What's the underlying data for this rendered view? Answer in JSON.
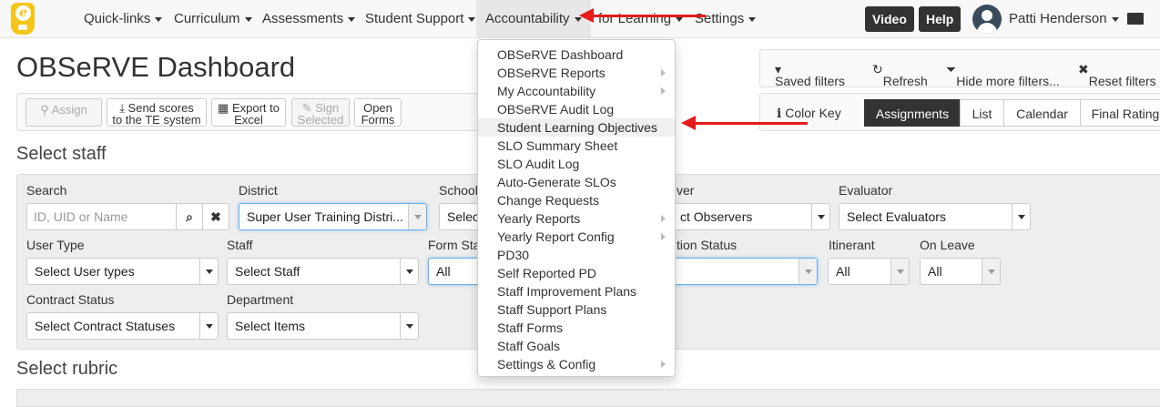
{
  "nav": {
    "items": [
      "Quick-links",
      "Curriculum",
      "Assessments",
      "Student Support",
      "Accountability",
      "for Learning",
      "Settings"
    ],
    "video": "Video",
    "help": "Help",
    "user": "Patti Henderson"
  },
  "page": {
    "title": "OBSeRVE Dashboard"
  },
  "toolbar": {
    "assign": "Assign",
    "send_scores_1": "Send scores",
    "send_scores_2": "to the TE system",
    "export_1": "Export to",
    "export_2": "Excel",
    "sign_1": "Sign",
    "sign_2": "Selected",
    "open_1": "Open",
    "open_2": "Forms"
  },
  "filters": {
    "saved": "Saved filters",
    "refresh": "Refresh",
    "hide": "Hide more filters...",
    "reset": "Reset filters"
  },
  "view": {
    "color_key": "Color Key",
    "tabs": [
      "Assignments",
      "List",
      "Calendar",
      "Final Rating"
    ]
  },
  "sections": {
    "staff": "Select staff",
    "rubric": "Select rubric"
  },
  "form": {
    "search_label": "Search",
    "search_placeholder": "ID, UID or Name",
    "district_label": "District",
    "district_value": "Super User Training Distri...",
    "school_label": "School",
    "school_value": "Selec",
    "observer_label": "ver",
    "observer_value": "ct Observers",
    "evaluator_label": "Evaluator",
    "evaluator_value": "Select Evaluators",
    "user_type_label": "User Type",
    "user_type_value": "Select User types",
    "staff_label": "Staff",
    "staff_value": "Select Staff",
    "form_status_label": "Form Sta",
    "form_status_value": "All",
    "completion_label": "tion Status",
    "completion_value": "",
    "itinerant_label": "Itinerant",
    "itinerant_value": "All",
    "on_leave_label": "On Leave",
    "on_leave_value": "All",
    "contract_label": "Contract Status",
    "contract_value": "Select Contract Statuses",
    "department_label": "Department",
    "department_value": "Select Items"
  },
  "menu": {
    "items": [
      {
        "label": "OBSeRVE Dashboard"
      },
      {
        "label": "OBSeRVE Reports"
      },
      {
        "label": "My Accountability"
      },
      {
        "label": "OBSeRVE Audit Log"
      },
      {
        "label": "Student Learning Objectives"
      },
      {
        "label": "SLO Summary Sheet"
      },
      {
        "label": "SLO Audit Log"
      },
      {
        "label": "Auto-Generate SLOs"
      },
      {
        "label": "Change Requests"
      },
      {
        "label": "Yearly Reports"
      },
      {
        "label": "Yearly Report Config"
      },
      {
        "label": "PD30"
      },
      {
        "label": "Self Reported PD"
      },
      {
        "label": "Staff Improvement Plans"
      },
      {
        "label": "Staff Support Plans"
      },
      {
        "label": "Staff Forms"
      },
      {
        "label": "Staff Goals"
      },
      {
        "label": "Settings & Config"
      }
    ]
  },
  "colors": {
    "accent_red": "#e41c1c",
    "dark_button": "#333333",
    "logo_yellow": "#f5c518"
  }
}
